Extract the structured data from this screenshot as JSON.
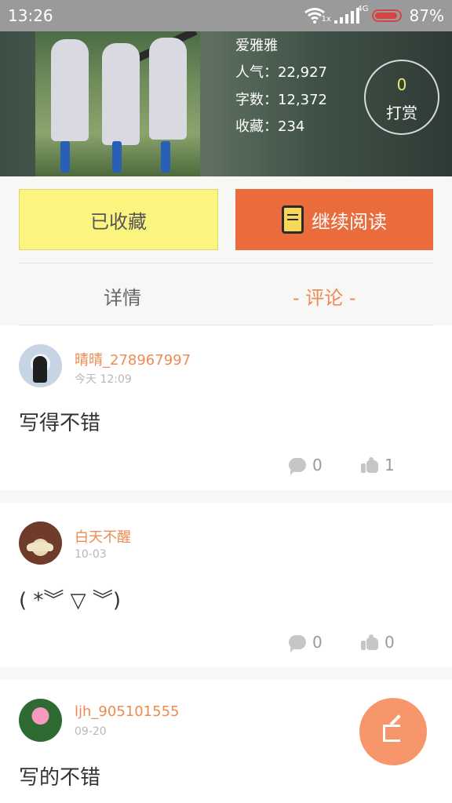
{
  "status_bar": {
    "time": "13:26",
    "network": "4G",
    "sim": "1x",
    "battery": "87%"
  },
  "book": {
    "author": "爱雅雅",
    "popularity": "人气：22,927",
    "word_count": "字数：12,372",
    "favorites": "收藏：234",
    "tip_count": "0",
    "tip_label": "打赏"
  },
  "actions": {
    "collected_label": "已收藏",
    "continue_label": "继续阅读"
  },
  "tabs": {
    "details": "详情",
    "comments": "- 评论 -"
  },
  "comments": [
    {
      "name": "晴晴_278967997",
      "time": "今天 12:09",
      "content": "写得不错",
      "replies": "0",
      "likes": "1"
    },
    {
      "name": "白天不醒",
      "time": "10-03",
      "content": "( *︾ ▽ ︾)",
      "replies": "0",
      "likes": "0"
    },
    {
      "name": "ljh_905101555",
      "time": "09-20",
      "content": "写的不错"
    }
  ],
  "colors": {
    "accent": "#ea6b3c",
    "collected_bg": "#fbf47f",
    "comment_name": "#ef8a52",
    "fab": "#f7956b"
  }
}
